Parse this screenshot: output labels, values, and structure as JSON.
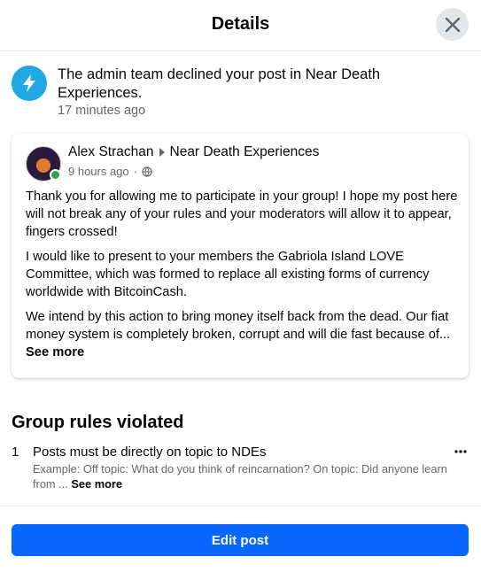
{
  "dialog": {
    "title": "Details",
    "close_icon": "close-icon"
  },
  "notification": {
    "icon": "lightning-bolt-icon",
    "text": "The admin team declined your post in Near Death Experiences.",
    "time": "17 minutes ago"
  },
  "post": {
    "author": "Alex Strachan",
    "group": "Near Death Experiences",
    "time": "9 hours ago",
    "separator": "·",
    "privacy_icon": "globe-icon",
    "paragraphs": [
      "Thank you for allowing me to participate in your group! I hope my post here will not break any of your rules and your moderators will allow it to appear, fingers crossed!",
      "I would like to present to your members the Gabriola Island LOVE Committee, which was formed to replace all existing forms of currency worldwide with BitcoinCash.",
      "We intend by this action to bring money itself back from the dead. Our fiat money system is completely broken, corrupt and will die fast because of..."
    ],
    "see_more": "See more"
  },
  "rules": {
    "title": "Group rules violated",
    "items": [
      {
        "number": "1",
        "title": "Posts must be directly on topic to NDEs",
        "description": "Example: Off topic: What do you think of reincarnation? On topic: Did anyone learn from ...",
        "see_more": "See more"
      }
    ]
  },
  "footer": {
    "edit_label": "Edit post"
  },
  "colors": {
    "primary_button": "#0866ff",
    "notification_icon_bg": "#1fa8e3",
    "online_dot": "#31a24c",
    "secondary_text": "#65676b"
  }
}
